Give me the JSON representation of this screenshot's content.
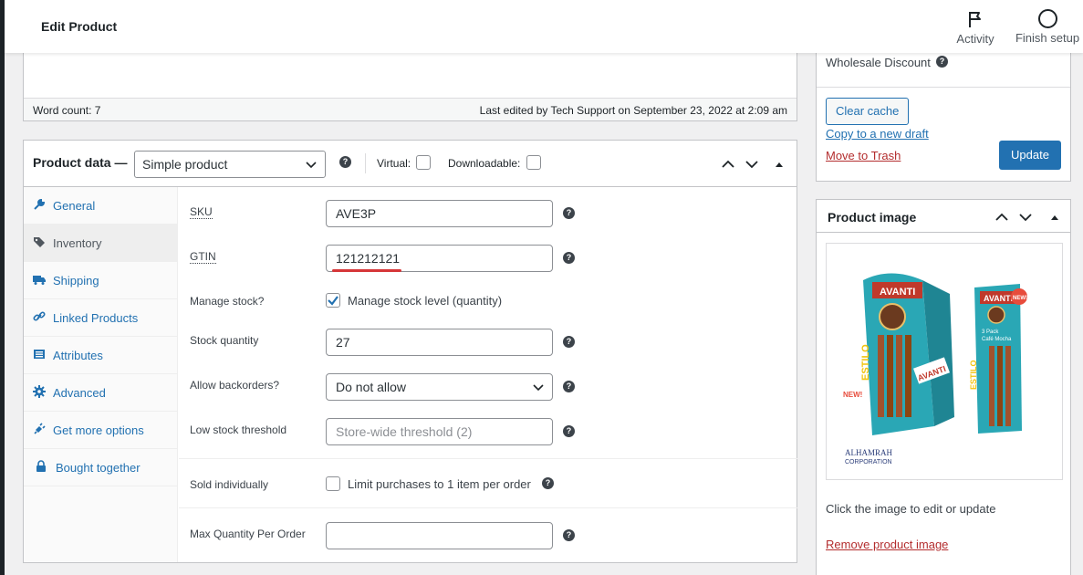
{
  "topbar": {
    "title": "Edit Product",
    "activity_label": "Activity",
    "finish_setup_label": "Finish setup"
  },
  "editor": {
    "word_count": "Word count: 7",
    "last_edited": "Last edited by Tech Support on September 23, 2022 at 2:09 am"
  },
  "product_data": {
    "heading": "Product data —",
    "type_value": "Simple product",
    "virtual_label": "Virtual:",
    "downloadable_label": "Downloadable:",
    "tabs": [
      {
        "label": "General",
        "icon": "wrench-icon"
      },
      {
        "label": "Inventory",
        "icon": "tag-icon"
      },
      {
        "label": "Shipping",
        "icon": "truck-icon"
      },
      {
        "label": "Linked Products",
        "icon": "link-icon"
      },
      {
        "label": "Attributes",
        "icon": "list-icon"
      },
      {
        "label": "Advanced",
        "icon": "gear-icon"
      },
      {
        "label": "Get more options",
        "icon": "plugin-icon"
      },
      {
        "label": "Bought together",
        "icon": "lock-icon"
      }
    ],
    "active_tab": "Inventory",
    "fields": {
      "sku_label": "SKU",
      "sku_value": "AVE3P",
      "gtin_label": "GTIN",
      "gtin_value": "121212121",
      "manage_stock_label": "Manage stock?",
      "manage_stock_text": "Manage stock level (quantity)",
      "manage_stock_checked": true,
      "stock_qty_label": "Stock quantity",
      "stock_qty_value": "27",
      "backorders_label": "Allow backorders?",
      "backorders_value": "Do not allow",
      "low_stock_label": "Low stock threshold",
      "low_stock_placeholder": "Store-wide threshold (2)",
      "sold_individually_label": "Sold individually",
      "sold_individually_text": "Limit purchases to 1 item per order",
      "max_qty_label": "Max Quantity Per Order",
      "max_qty_value": ""
    }
  },
  "publish": {
    "wholesale_label": "Wholesale Discount",
    "clear_cache": "Clear cache",
    "copy_draft": "Copy to a new draft",
    "move_trash": "Move to Trash",
    "update": "Update"
  },
  "product_image": {
    "heading": "Product image",
    "brand_text": "AVANTI",
    "sub_brand": "ESTILO",
    "pack_text": "3 Pack",
    "flavor_text": "Café Mocha",
    "badge_text": "NEW!",
    "corp_name": "ALHAMRAH",
    "corp_sub": "CORPORATION",
    "edit_hint": "Click the image to edit or update",
    "remove": "Remove product image"
  },
  "colors": {
    "accent": "#2271b1",
    "danger": "#b32d2e",
    "underline_mark": "#d63638",
    "package_teal": "#2aa7b5"
  }
}
